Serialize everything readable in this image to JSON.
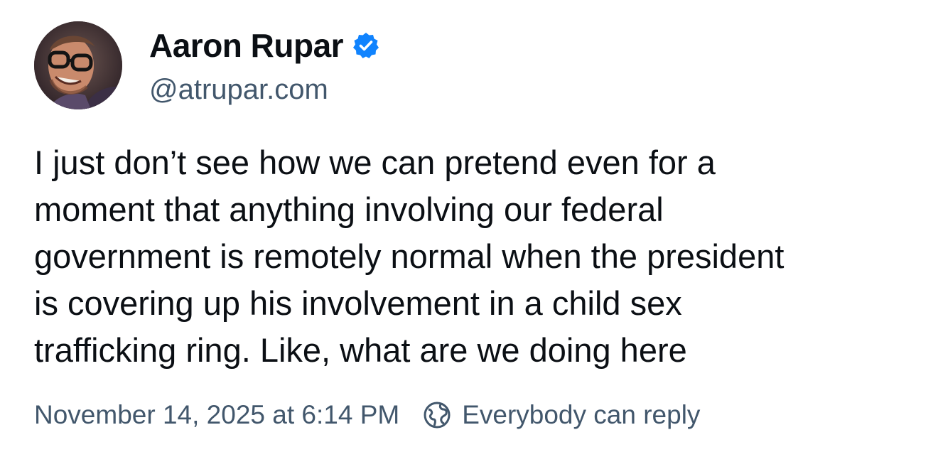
{
  "author": {
    "display_name": "Aaron Rupar",
    "handle": "@atrupar.com",
    "verified_icon": "verified-check-icon",
    "avatar": "avatar-photo"
  },
  "post": {
    "text_lines": [
      "I just don’t see how we can pretend even for a",
      "moment that anything involving our federal",
      "government is remotely normal when the president",
      "is covering up his involvement in a child sex",
      "trafficking ring. Like, what are we doing here"
    ],
    "timestamp": "November 14, 2025 at 6:14 PM",
    "reply_setting": "Everybody can reply",
    "reply_icon": "globe-icon"
  },
  "colors": {
    "text": "#0b0f14",
    "muted": "#42576c",
    "accent": "#1083fe",
    "background": "#ffffff"
  }
}
